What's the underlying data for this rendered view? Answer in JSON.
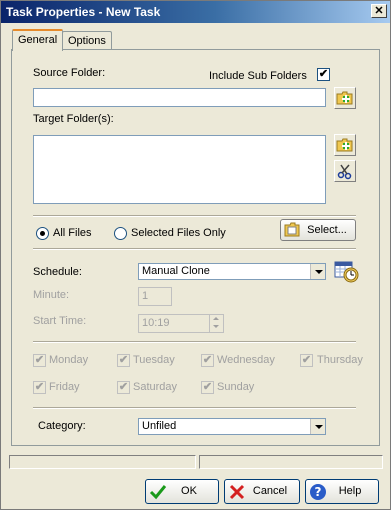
{
  "window": {
    "title": "Task Properties - New Task",
    "close_glyph": "✕"
  },
  "tabs": [
    {
      "label": "General",
      "active": true
    },
    {
      "label": "Options",
      "active": false
    }
  ],
  "general": {
    "source_folder_label": "Source Folder:",
    "source_folder_value": "",
    "include_sub_folders_label": "Include Sub Folders",
    "include_sub_folders_checked": true,
    "check_glyph": "✔",
    "target_folders_label": "Target Folder(s):",
    "target_folders_value": "",
    "file_scope": {
      "all_files_label": "All Files",
      "selected_files_label": "Selected Files Only",
      "selected": "all"
    },
    "select_button_label": "Select...",
    "schedule_label": "Schedule:",
    "schedule_value": "Manual Clone",
    "minute_label": "Minute:",
    "minute_value": "1",
    "start_time_label": "Start Time:",
    "start_time_value": "10:19",
    "days": [
      {
        "label": "Monday",
        "checked": true
      },
      {
        "label": "Tuesday",
        "checked": true
      },
      {
        "label": "Wednesday",
        "checked": true
      },
      {
        "label": "Thursday",
        "checked": true
      },
      {
        "label": "Friday",
        "checked": true
      },
      {
        "label": "Saturday",
        "checked": true
      },
      {
        "label": "Sunday",
        "checked": true
      }
    ],
    "category_label": "Category:",
    "category_value": "Unfiled"
  },
  "buttons": {
    "ok_label": "OK",
    "cancel_label": "Cancel",
    "help_label": "Help"
  },
  "icons": {
    "add_folder": "folder-add-icon",
    "remove": "scissors-icon",
    "calendar": "calendar-clock-icon",
    "select": "folder-open-icon",
    "ok": "checkmark-icon",
    "cancel": "x-icon",
    "help": "help-icon"
  },
  "colors": {
    "title_bar": "#0a246a",
    "window_bg": "#ece9d8",
    "ok_green": "#1a9a1a",
    "cancel_red": "#d42020",
    "help_blue": "#2a5cc8"
  }
}
